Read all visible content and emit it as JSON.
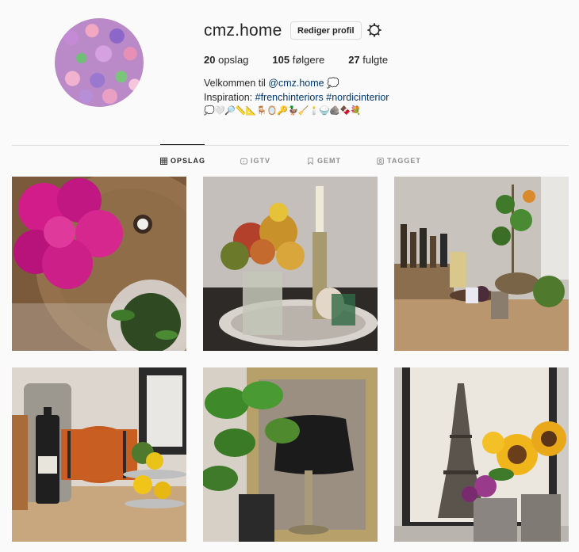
{
  "profile": {
    "username": "cmz.home",
    "edit_label": "Rediger profil",
    "stats": {
      "posts_count": "20",
      "posts_label": "opslag",
      "followers_count": "105",
      "followers_label": "følgere",
      "following_count": "27",
      "following_label": "fulgte"
    },
    "bio": {
      "line1_text": "Velkommen til ",
      "line1_mention": "@cmz.home",
      "line1_emoji": "💭",
      "line2_text": "Inspiration: ",
      "line2_tag1": "#frenchinteriors",
      "line2_tag2": "#nordicinterior",
      "line3_emojis": "💭🤍🔎📏📐🪑🪞🔑🦆🧹🕯️🍚🪨🍫💐"
    }
  },
  "tabs": [
    {
      "label": "OPSLAG",
      "icon": "grid-icon",
      "active": true
    },
    {
      "label": "IGTV",
      "icon": "igtv-icon",
      "active": false
    },
    {
      "label": "GEMT",
      "icon": "bookmark-icon",
      "active": false
    },
    {
      "label": "TAGGET",
      "icon": "tagged-icon",
      "active": false
    }
  ],
  "posts": [
    {
      "name": "post-pink-dahlias"
    },
    {
      "name": "post-candle-tray-flowers"
    },
    {
      "name": "post-bar-cart-corner"
    },
    {
      "name": "post-wine-barrel-fruit"
    },
    {
      "name": "post-monstera-lamp-mirror"
    },
    {
      "name": "post-eiffel-sunflowers"
    }
  ],
  "colors": {
    "link": "#00376b",
    "text": "#262626",
    "muted": "#8e8e8e",
    "background": "#fafafa",
    "border": "#dbdbdb"
  }
}
